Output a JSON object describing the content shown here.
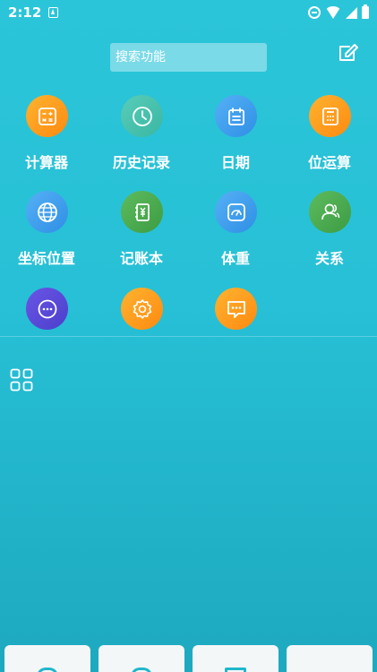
{
  "status_bar": {
    "time": "2:12"
  },
  "search": {
    "placeholder": "搜索功能"
  },
  "colors": {
    "background": "#27c0d6",
    "orange": "#ff9f1c",
    "teal": "#3cc2a5",
    "blue": "#3b9bea",
    "green": "#4cae4f",
    "purple": "#5a4fd6"
  },
  "grid": {
    "items": [
      {
        "label": "计算器",
        "icon": "calculator-icon",
        "color": "#ff9a1f"
      },
      {
        "label": "历史记录",
        "icon": "clock-icon",
        "color": "#45c3ad"
      },
      {
        "label": "日期",
        "icon": "calendar-icon",
        "color": "#3f9ff0"
      },
      {
        "label": "位运算",
        "icon": "calculator-grid-icon",
        "color": "#ff9a1f"
      },
      {
        "label": "坐标位置",
        "icon": "globe-icon",
        "color": "#3f9ff0"
      },
      {
        "label": "记账本",
        "icon": "ledger-icon",
        "color": "#48a84c"
      },
      {
        "label": "体重",
        "icon": "scale-icon",
        "color": "#3f9ff0"
      },
      {
        "label": "关系",
        "icon": "person-icon",
        "color": "#48a84c"
      },
      {
        "label": "",
        "icon": "more-icon",
        "color": "#5a4bd8"
      },
      {
        "label": "",
        "icon": "settings-icon",
        "color": "#ff9a1f"
      },
      {
        "label": "",
        "icon": "message-icon",
        "color": "#ff9a1f"
      }
    ]
  }
}
